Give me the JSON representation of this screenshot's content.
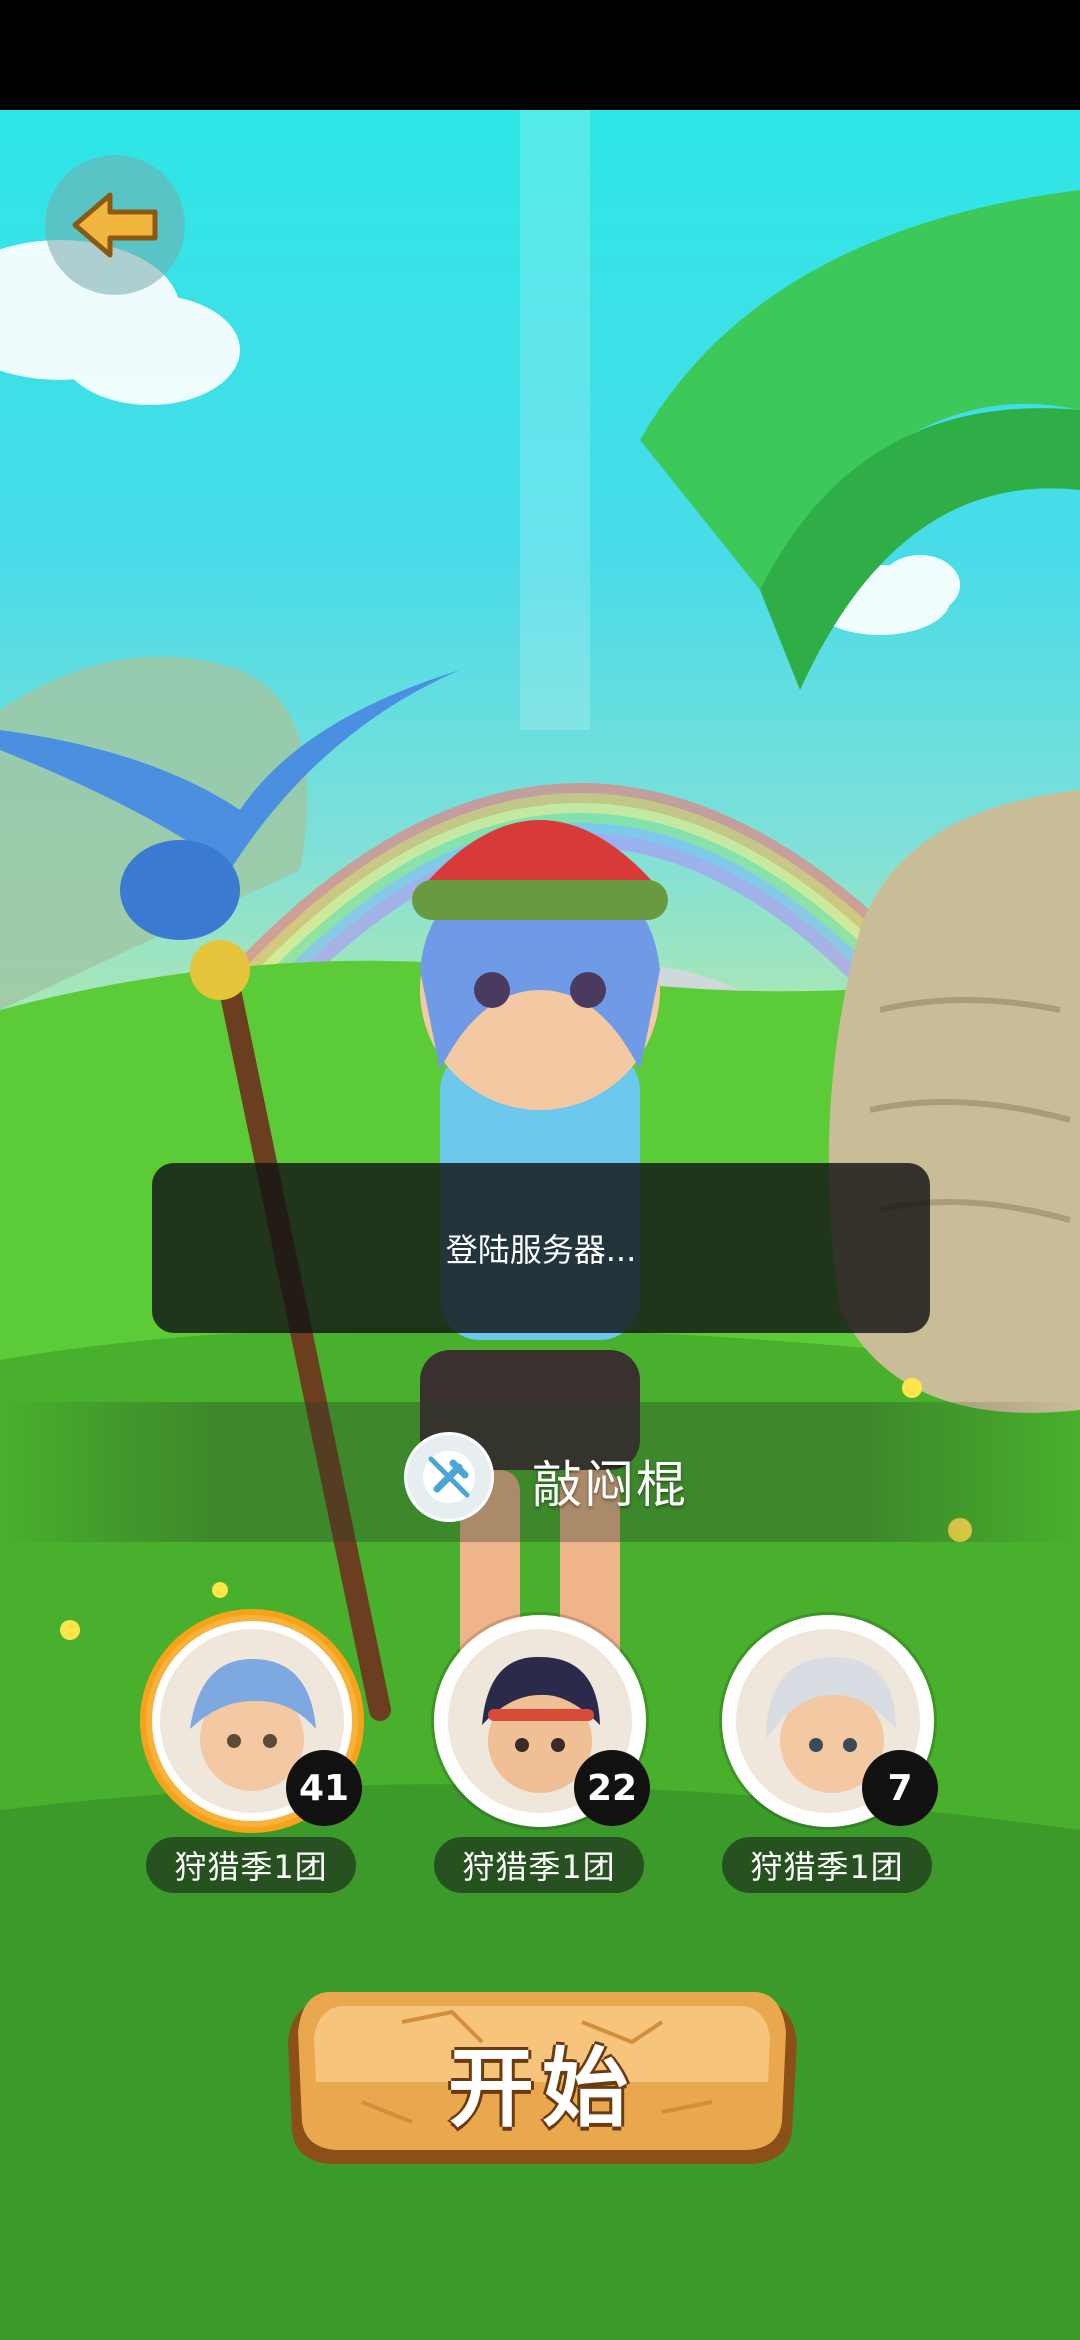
{
  "toast": {
    "message": "登陆服务器..."
  },
  "weapon": {
    "name": "敲闷棍",
    "icon": "no-weapon-icon"
  },
  "characters": [
    {
      "level": "41",
      "team": "狩猎季1团",
      "selected": true,
      "hair_color": "#7ea8e0"
    },
    {
      "level": "22",
      "team": "狩猎季1团",
      "selected": false,
      "hair_color": "#2c2a4a"
    },
    {
      "level": "7",
      "team": "狩猎季1团",
      "selected": false,
      "hair_color": "#d8dde4"
    }
  ],
  "start_button": {
    "label": "开始"
  },
  "colors": {
    "accent": "#f6a21a",
    "button": "#e9a64a",
    "toast_bg": "#141414"
  }
}
